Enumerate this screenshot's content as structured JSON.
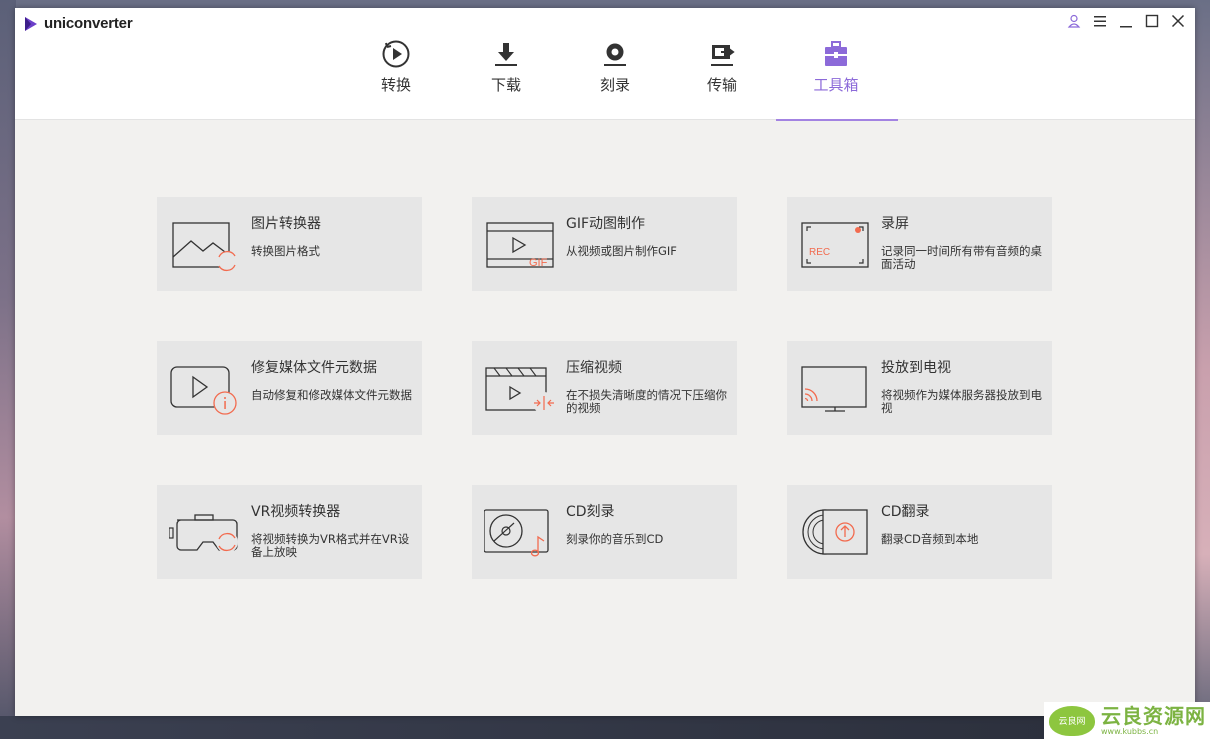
{
  "app": {
    "name": "uniconverter"
  },
  "nav": {
    "tabs": [
      {
        "label": "转换",
        "icon": "convert-icon"
      },
      {
        "label": "下载",
        "icon": "download-icon"
      },
      {
        "label": "刻录",
        "icon": "burn-icon"
      },
      {
        "label": "传输",
        "icon": "transfer-icon"
      },
      {
        "label": "工具箱",
        "icon": "toolbox-icon",
        "active": true
      }
    ],
    "accent_color": "#8c6ad9"
  },
  "window_controls": [
    "user-icon",
    "menu-icon",
    "minimize-icon",
    "maximize-icon",
    "close-icon"
  ],
  "toolbox": {
    "cards": [
      {
        "title": "图片转换器",
        "desc": "转换图片格式",
        "icon": "image-convert-icon"
      },
      {
        "title": "GIF动图制作",
        "desc": "从视频或图片制作GIF",
        "icon": "gif-maker-icon"
      },
      {
        "title": "录屏",
        "desc": "记录同一时间所有带有音频的桌面活动",
        "icon": "screen-record-icon"
      },
      {
        "title": "修复媒体文件元数据",
        "desc": "自动修复和修改媒体文件元数据",
        "icon": "fix-metadata-icon"
      },
      {
        "title": "压缩视频",
        "desc": "在不损失清晰度的情况下压缩你的视频",
        "icon": "compress-video-icon"
      },
      {
        "title": "投放到电视",
        "desc": "将视频作为媒体服务器投放到电视",
        "icon": "cast-tv-icon"
      },
      {
        "title": "VR视频转换器",
        "desc": "将视频转换为VR格式并在VR设备上放映",
        "icon": "vr-convert-icon"
      },
      {
        "title": "CD刻录",
        "desc": "刻录你的音乐到CD",
        "icon": "cd-burn-icon"
      },
      {
        "title": "CD翻录",
        "desc": "翻录CD音频到本地",
        "icon": "cd-rip-icon"
      }
    ],
    "highlight_color": "#f26b4f"
  },
  "watermark": {
    "main": "云良资源网",
    "sub": "www.kubbs.cn",
    "badge": "云良网"
  }
}
